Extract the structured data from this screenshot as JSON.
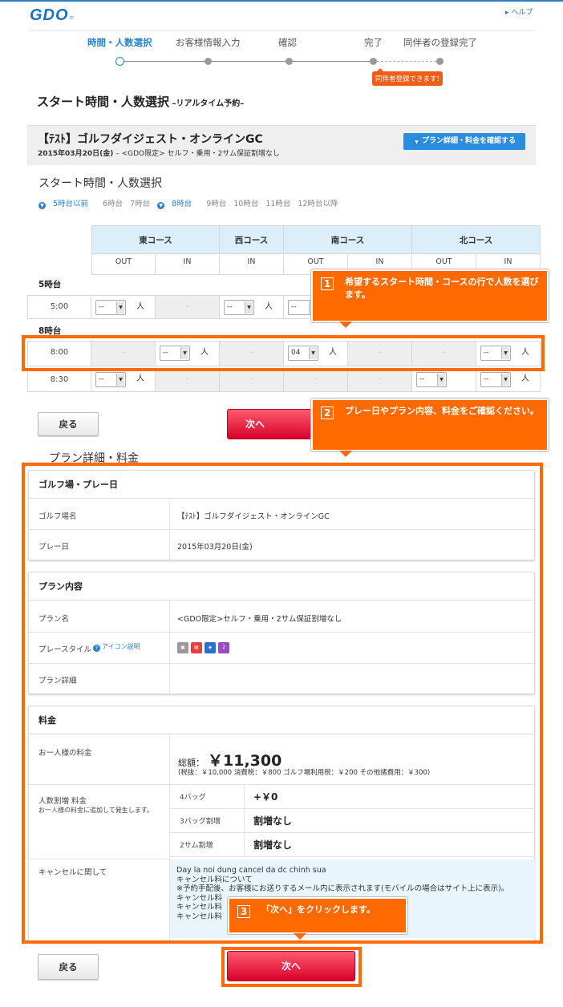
{
  "header": {
    "logo": "GDO",
    "help": "ヘルプ"
  },
  "steps": [
    {
      "label": "時間・人数選択",
      "active": true
    },
    {
      "label": "お客様情報入力"
    },
    {
      "label": "確認"
    },
    {
      "label": "完了"
    },
    {
      "label": "同伴者の登録完了"
    }
  ],
  "steps_badge": "同伴者登録できます!",
  "page_title": "スタート時間・人数選択",
  "page_title_sub": " –リアルタイム予約–",
  "course": {
    "name": "【ﾃｽﾄ】ゴルフダイジェスト・オンラインGC",
    "date": "2015年03月20日(金)",
    "plan_line": "– <GDO限定> セルフ・乗用・2サム保証割増なし",
    "plan_button": "プラン詳細・料金を確認する"
  },
  "start_heading": "スタート時間・人数選択",
  "hours": [
    {
      "label": "5時台以前",
      "link": true
    },
    {
      "label": "6時台"
    },
    {
      "label": "7時台"
    },
    {
      "label": "8時台",
      "link": true
    },
    {
      "label": "9時台"
    },
    {
      "label": "10時台"
    },
    {
      "label": "11時台"
    },
    {
      "label": "12時台以降"
    }
  ],
  "grid": {
    "courses": [
      "東コース",
      "西コース",
      "南コース",
      "北コース"
    ],
    "sub": [
      "OUT",
      "IN",
      "IN",
      "OUT",
      "IN",
      "OUT",
      "IN"
    ],
    "group5": "5時台",
    "group8": "8時台",
    "rows": [
      {
        "time": "5:00",
        "cells": [
          "--",
          "-",
          "--",
          "--"
        ]
      },
      {
        "time": "8:00",
        "cells": [
          "-",
          "--",
          "-",
          "04",
          "-",
          "-",
          "--"
        ]
      },
      {
        "time": "8:30",
        "cells": [
          "--",
          "-",
          "-",
          "-",
          "-",
          "--",
          "--"
        ]
      }
    ],
    "person": "人",
    "dash": "-"
  },
  "callouts": [
    {
      "num": "1",
      "text": "希望するスタート時間・コースの行で人数を選びます。"
    },
    {
      "num": "2",
      "text": "プレー日やプラン内容、料金をご確認ください。"
    },
    {
      "num": "3",
      "text": "「次へ」をクリックします。"
    }
  ],
  "buttons": {
    "back": "戻る",
    "next": "次へ"
  },
  "plan_label": "プラン詳細・料金",
  "golf": {
    "head": "ゴルフ場・プレー日",
    "course_label": "ゴルフ場名",
    "course_value": "【ﾃｽﾄ】ゴルフダイジェスト・オンラインGC",
    "date_label": "プレー日",
    "date_value": "2015年03月20日(金)"
  },
  "plan": {
    "head": "プラン内容",
    "name_label": "プラン名",
    "name_value": "<GDO限定>セルフ・乗用・2サム保証割増なし",
    "style_label": "プレースタイル",
    "icon_help": "アイコン説明",
    "detail_label": "プラン詳細"
  },
  "fee": {
    "head": "料金",
    "per_person": "お一人様の料金",
    "total_label": "総額：",
    "total": "￥11,300",
    "breakdown": "(税抜：￥10,000  消費税：￥800  ゴルフ場利用税：￥200  その他諸費用：￥300)",
    "surcharge_label": "人数割増 料金",
    "surcharge_note": "お一人様の料金に追加して発生します。",
    "surcharges": [
      {
        "label": "4バッグ",
        "value": "+￥0"
      },
      {
        "label": "3バッグ割増",
        "value": "割増なし"
      },
      {
        "label": "2サム割増",
        "value": "割増なし"
      }
    ],
    "cancel_label": "キャンセルに関して",
    "cancel_lines": [
      "Day la noi dung cancel da dc chinh sua",
      "キャンセル料について",
      "※予約手配後、お客様にお送りするメール内に表示されます(モバイルの場合はサイト上に表示)。",
      "キャンセル料",
      "キャンセル料",
      "キャンセル料"
    ]
  },
  "colors": {
    "accent": "#2a82cf",
    "orange": "#ff6a00",
    "next": "#e8113a"
  }
}
